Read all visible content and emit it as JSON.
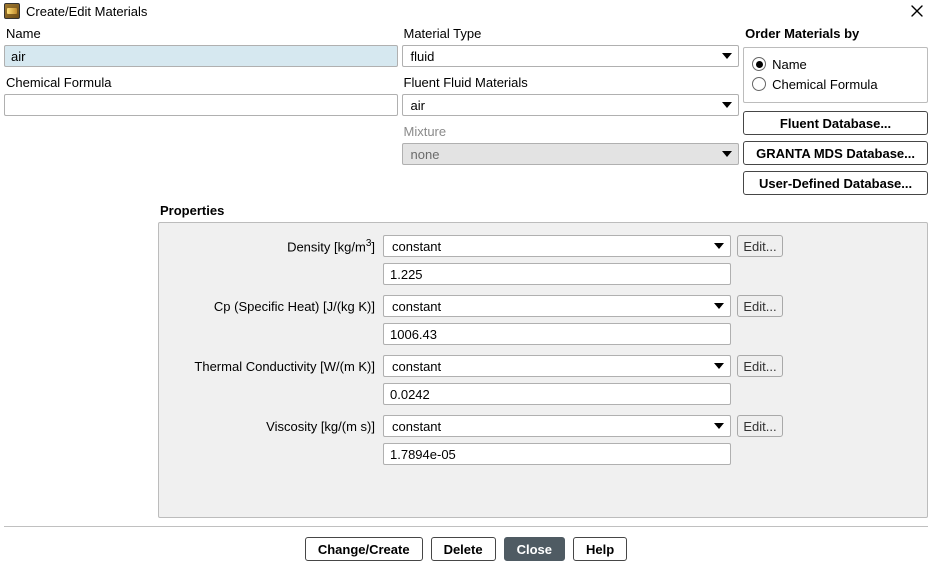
{
  "window": {
    "title": "Create/Edit Materials"
  },
  "labels": {
    "name": "Name",
    "chemical_formula": "Chemical Formula",
    "material_type": "Material Type",
    "fluent_fluid_materials": "Fluent Fluid Materials",
    "mixture": "Mixture",
    "order_by": "Order Materials by",
    "properties": "Properties"
  },
  "fields": {
    "name_value": "air",
    "chemical_formula_value": "",
    "material_type_value": "fluid",
    "fluent_fluid_materials_value": "air",
    "mixture_value": "none"
  },
  "order": {
    "name_label": "Name",
    "chemical_formula_label": "Chemical Formula",
    "selected": "Name"
  },
  "db_buttons": {
    "fluent": "Fluent Database...",
    "granta": "GRANTA MDS Database...",
    "user": "User-Defined Database..."
  },
  "edit_label": "Edit...",
  "properties": {
    "density": {
      "label_pre": "Density [kg/m",
      "label_sup": "3",
      "label_post": "]",
      "method": "constant",
      "value": "1.225"
    },
    "cp": {
      "label": "Cp (Specific Heat) [J/(kg K)]",
      "method": "constant",
      "value": "1006.43"
    },
    "k": {
      "label": "Thermal Conductivity [W/(m K)]",
      "method": "constant",
      "value": "0.0242"
    },
    "mu": {
      "label": "Viscosity [kg/(m s)]",
      "method": "constant",
      "value": "1.7894e-05"
    }
  },
  "footer": {
    "change_create": "Change/Create",
    "delete": "Delete",
    "close": "Close",
    "help": "Help"
  }
}
